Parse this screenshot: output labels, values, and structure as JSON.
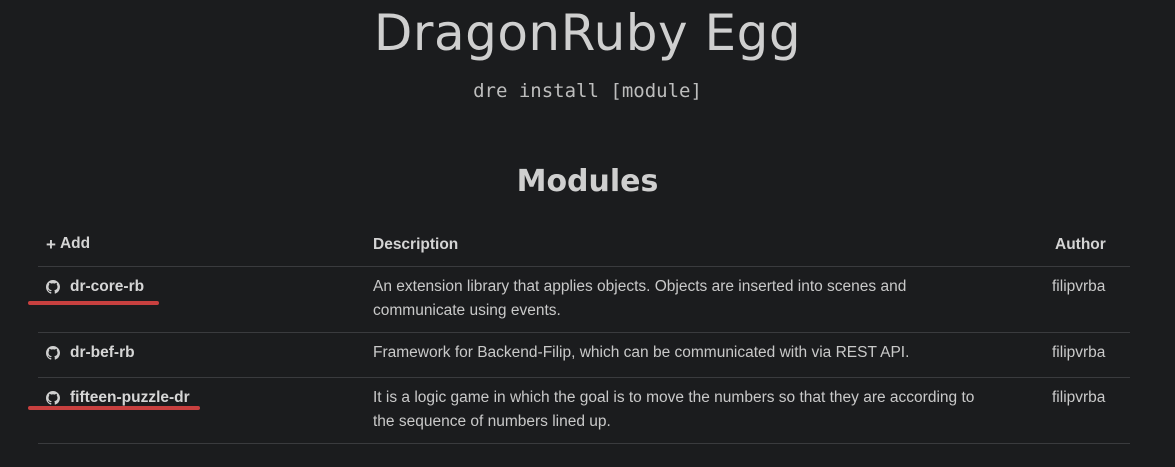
{
  "header": {
    "title": "DragonRuby Egg",
    "command": "dre install [module]"
  },
  "section": {
    "title": "Modules"
  },
  "table": {
    "add_label": "Add",
    "columns": [
      "Description",
      "Author"
    ],
    "rows": [
      {
        "name": "dr-core-rb",
        "description_lines": [
          "An extension library that applies objects. Objects are inserted into scenes and",
          "communicate using events."
        ],
        "author": "filipvrba",
        "highlighted": true
      },
      {
        "name": "dr-bef-rb",
        "description_lines": [
          "Framework for Backend-Filip, which can be communicated with via REST API."
        ],
        "author": "filipvrba",
        "highlighted": false
      },
      {
        "name": "fifteen-puzzle-dr",
        "description_lines": [
          "It is a logic game in which the goal is to move the numbers so that they are according to",
          "the sequence of numbers lined up."
        ],
        "author": "filipvrba",
        "highlighted": true
      }
    ]
  },
  "icons": {
    "row_icon": "github-icon",
    "add_icon": "plus-icon"
  },
  "colors": {
    "background": "#1b1c1e",
    "highlight_underline": "#c8403f"
  }
}
